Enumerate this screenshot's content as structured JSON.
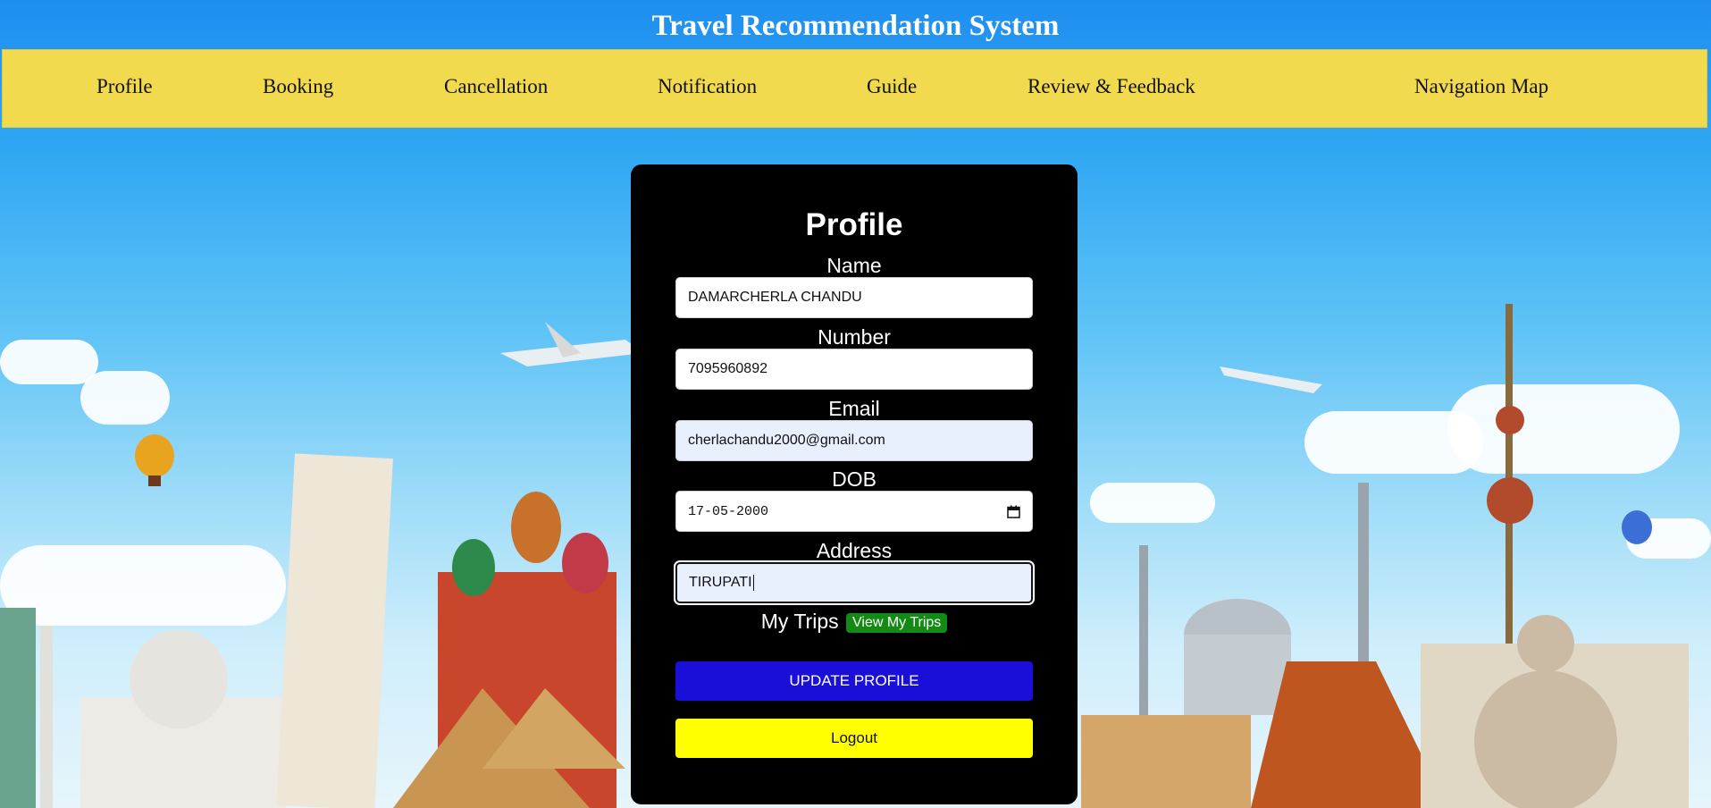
{
  "app": {
    "title": "Travel Recommendation System"
  },
  "nav": {
    "items": [
      {
        "id": "profile",
        "label": "Profile"
      },
      {
        "id": "booking",
        "label": "Booking"
      },
      {
        "id": "cancellation",
        "label": "Cancellation"
      },
      {
        "id": "notification",
        "label": "Notification"
      },
      {
        "id": "guide",
        "label": "Guide"
      },
      {
        "id": "review",
        "label": "Review & Feedback"
      },
      {
        "id": "navmap",
        "label": "Navigation Map"
      }
    ]
  },
  "profile": {
    "title": "Profile",
    "name": {
      "label": "Name",
      "value": "DAMARCHERLA CHANDU"
    },
    "number": {
      "label": "Number",
      "value": "7095960892"
    },
    "email": {
      "label": "Email",
      "value": "cherlachandu2000@gmail.com"
    },
    "dob": {
      "label": "DOB",
      "value": "17-05-2000"
    },
    "address": {
      "label": "Address",
      "value": "TIRUPATI"
    },
    "trips": {
      "label": "My Trips",
      "button": "View My Trips"
    },
    "update_button": "UPDATE PROFILE",
    "logout_button": "Logout"
  },
  "icons": {
    "calendar": "calendar-icon"
  },
  "colors": {
    "nav_background": "#f2da4f",
    "card_background": "#000000",
    "update_button": "#1a0fd8",
    "logout_button": "#ffff00",
    "trips_button": "#138a13"
  }
}
